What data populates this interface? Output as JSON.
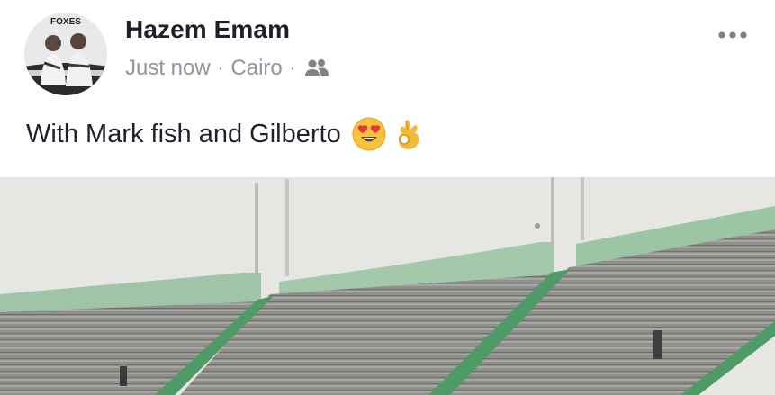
{
  "post": {
    "author": {
      "name": "Hazem Emam",
      "avatar_caption": "FOXES"
    },
    "meta": {
      "time": "Just now",
      "separator": "·",
      "location": "Cairo",
      "audience_icon": "friends-icon"
    },
    "more_icon": "more-horizontal-icon",
    "text": "With Mark fish and Gilberto",
    "emojis": [
      "heart-eyes-emoji",
      "ok-hand-emoji"
    ],
    "photo": {
      "subject": "stadium-stands"
    }
  },
  "colors": {
    "name_text": "#1d2129",
    "meta_text": "#90949c",
    "stand_green": "#5f9f73",
    "seat_gray": "#8a8a88",
    "sky": "#e7e7e5"
  }
}
